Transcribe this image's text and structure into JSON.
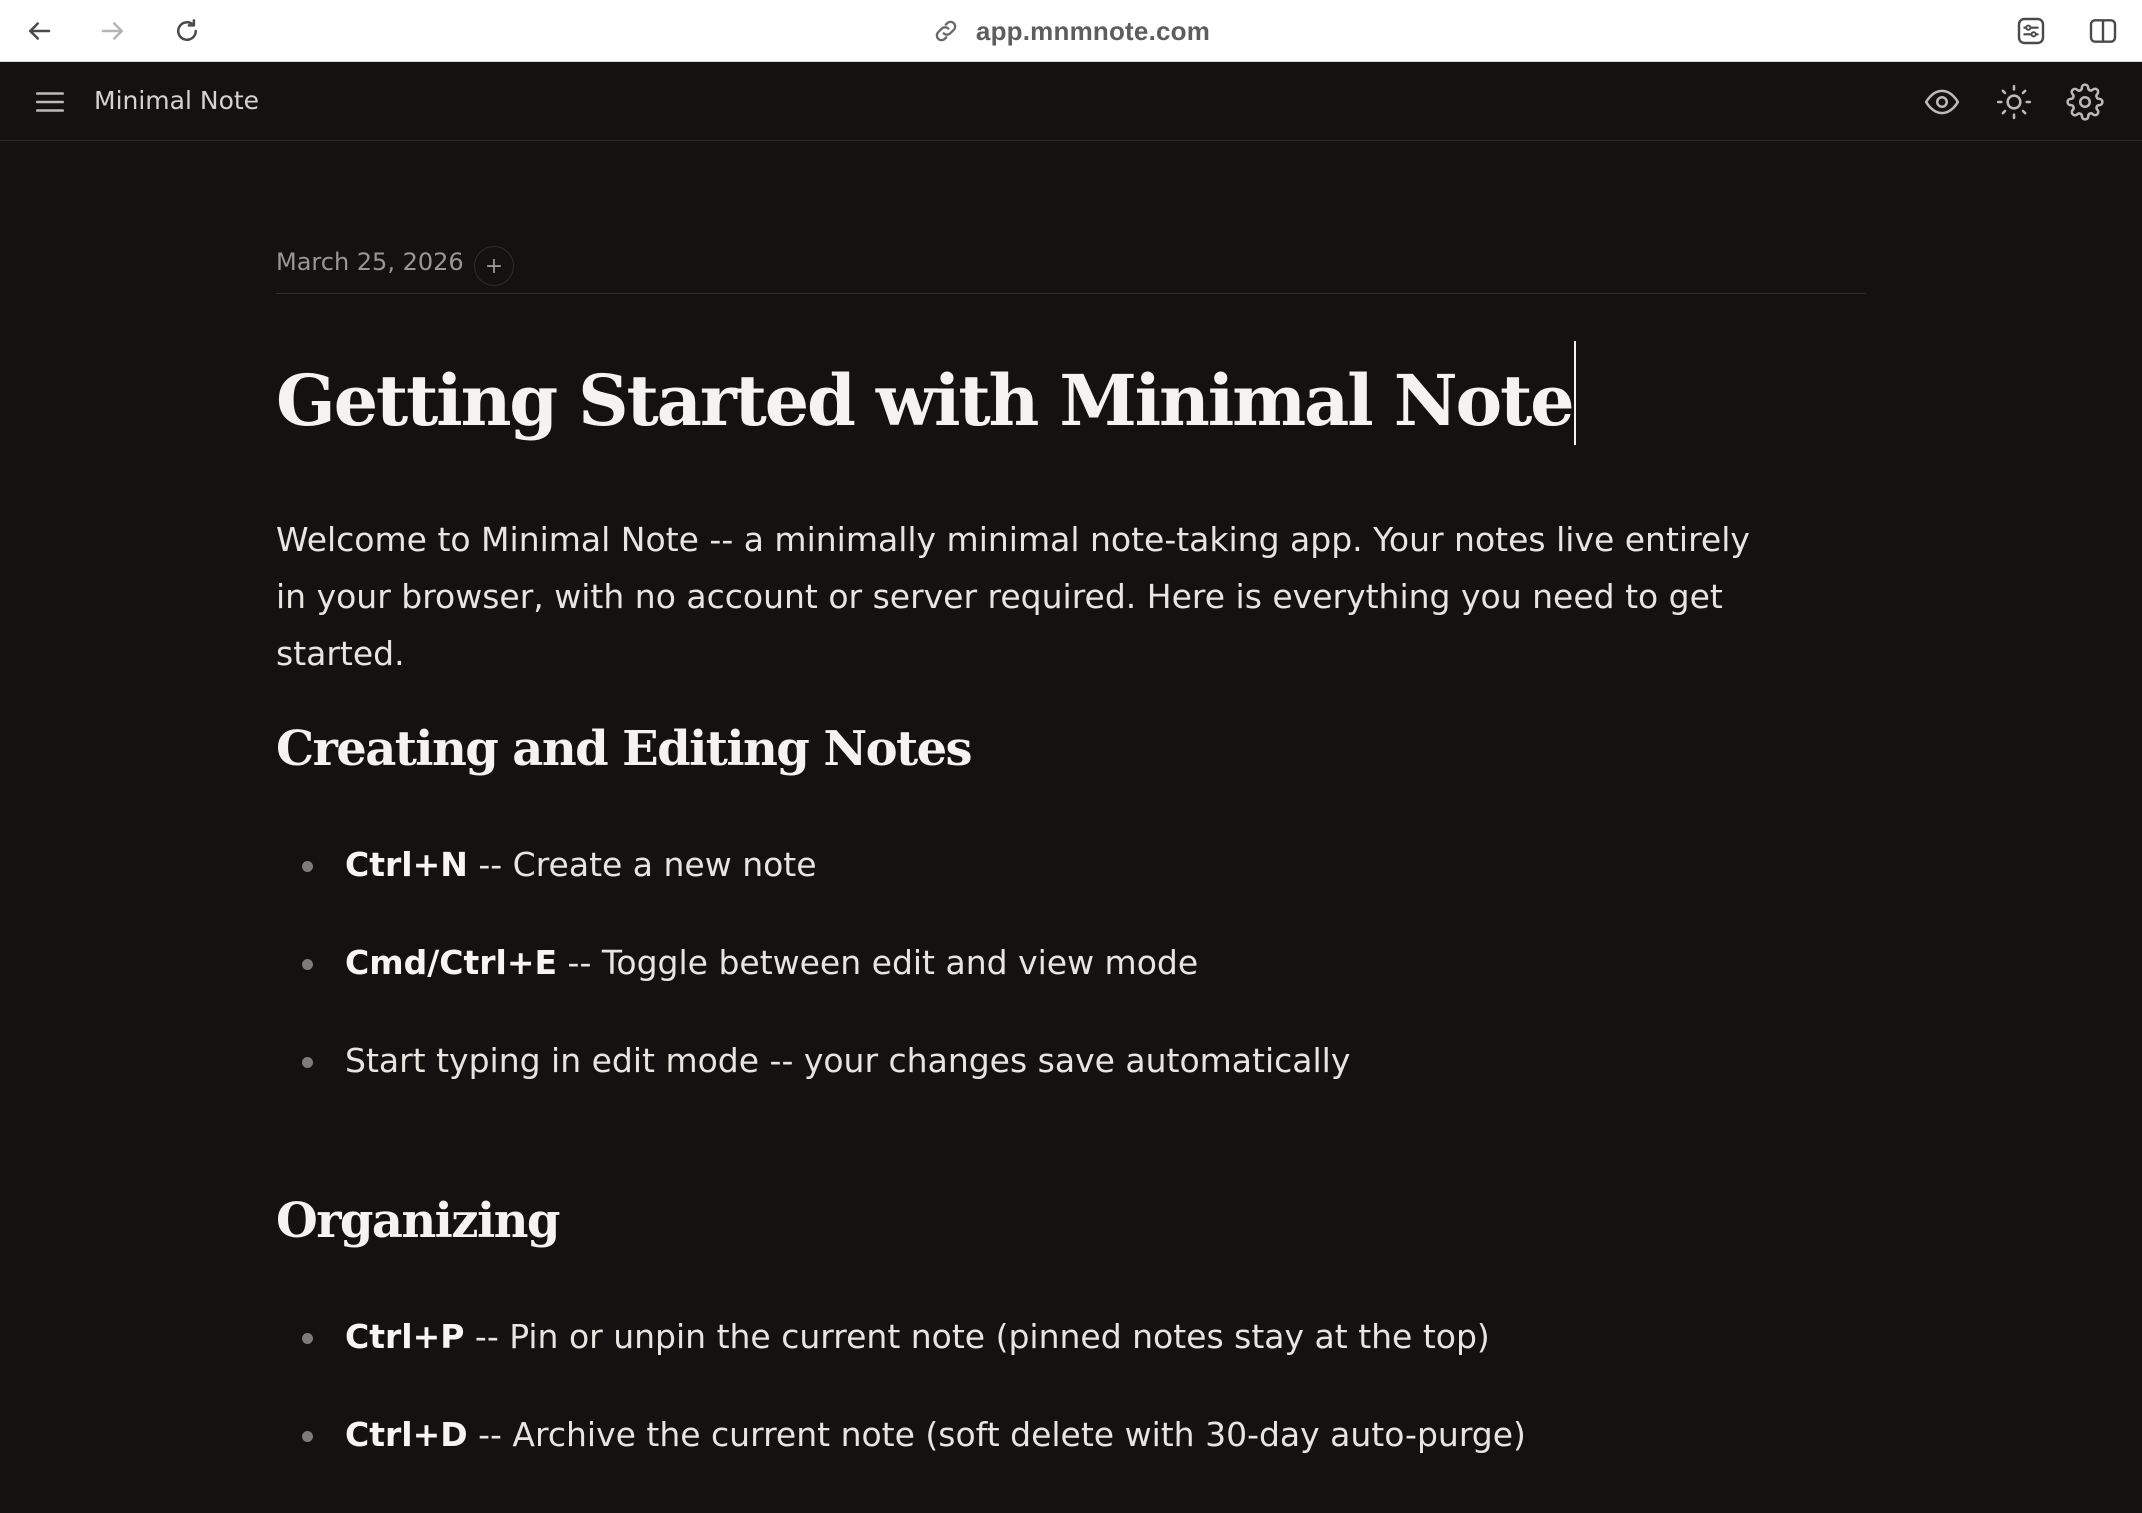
{
  "browser": {
    "url": "app.mnmnote.com",
    "icons": [
      "back-arrow-icon",
      "forward-arrow-icon",
      "reload-icon",
      "link-icon",
      "extension-icon",
      "sidebar-toggle-icon"
    ]
  },
  "app": {
    "title": "Minimal Note",
    "icons": [
      "menu-icon",
      "eye-icon",
      "sun-icon",
      "gear-icon"
    ]
  },
  "note": {
    "date": "March 25, 2026",
    "add_label": "+",
    "title": "Getting Started with Minimal Note",
    "intro": "Welcome to Minimal Note -- a minimally minimal note-taking app. Your notes live entirely in your browser, with no account or server required. Here is everything you need to get started.",
    "sections": [
      {
        "heading": "Creating and Editing Notes",
        "items": [
          {
            "key": "Ctrl+N",
            "text": " -- Create a new note"
          },
          {
            "key": "Cmd/Ctrl+E",
            "text": " -- Toggle between edit and view mode"
          },
          {
            "key": "",
            "text": "Start typing in edit mode -- your changes save automatically"
          }
        ]
      },
      {
        "heading": "Organizing",
        "items": [
          {
            "key": "Ctrl+P",
            "text": " -- Pin or unpin the current note (pinned notes stay at the top)"
          },
          {
            "key": "Ctrl+D",
            "text": " -- Archive the current note (soft delete with 30-day auto-purge)"
          }
        ]
      }
    ]
  },
  "colors": {
    "background": "#131211",
    "text": "#e8e5e1",
    "muted": "#9a9691",
    "heading": "#f5f3ef"
  }
}
